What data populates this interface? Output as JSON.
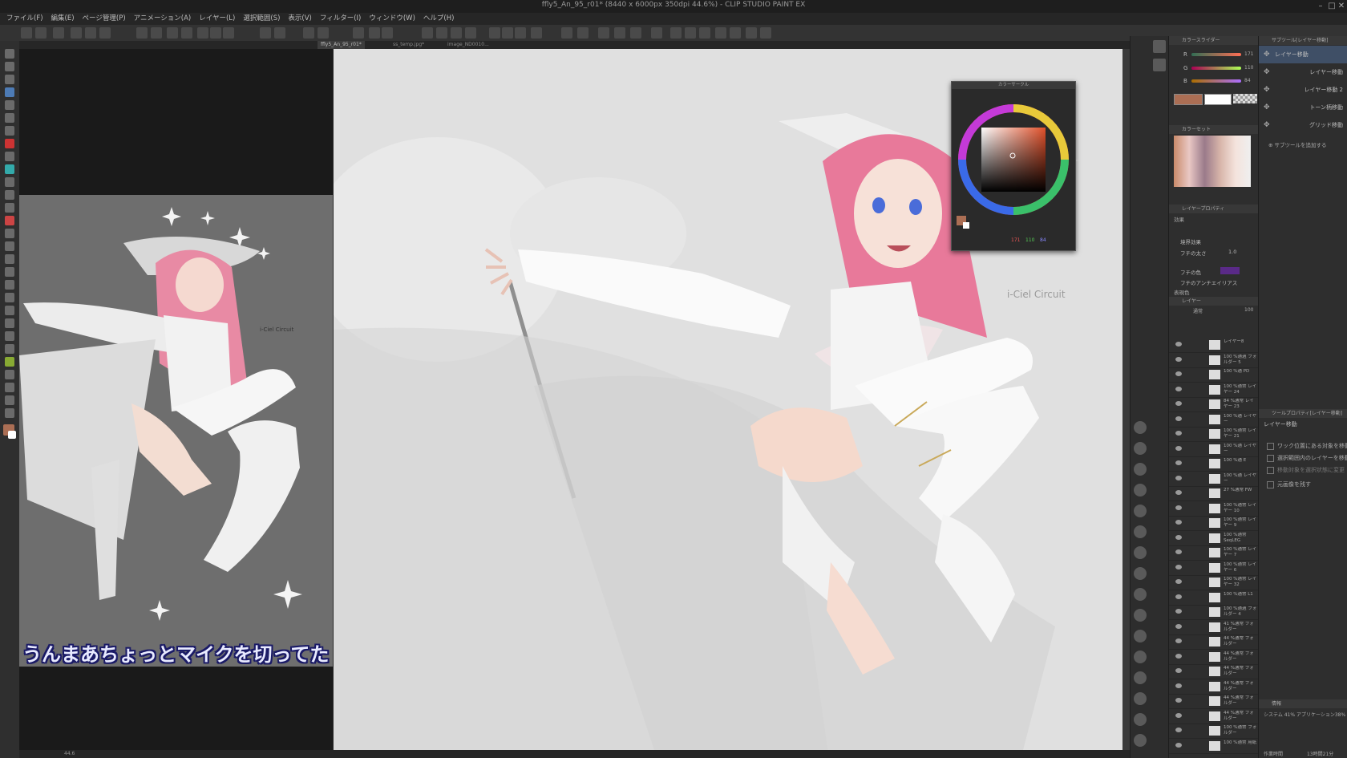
{
  "window": {
    "title": "ffly5_An_95_r01* (8440 x 6000px 350dpi 44.6%) - CLIP STUDIO PAINT EX",
    "controls": [
      "–",
      "□",
      "✕"
    ]
  },
  "menu": [
    "ファイル(F)",
    "編集(E)",
    "ページ管理(P)",
    "アニメーション(A)",
    "レイヤー(L)",
    "選択範囲(S)",
    "表示(V)",
    "フィルター(I)",
    "ウィンドウ(W)",
    "ヘルプ(H)"
  ],
  "tabs": [
    "ffly5_An_95_r01*",
    "ss_temp.jpg*",
    "image_ND0010..."
  ],
  "subtitle": "うんまあちょっとマイクを切ってた",
  "sketch_note": "i-Ciel Circuit",
  "color_slider": {
    "title": "カラースライダー",
    "rows": [
      {
        "label": "R",
        "value": "171"
      },
      {
        "label": "G",
        "value": "110"
      },
      {
        "label": "B",
        "value": "84"
      }
    ],
    "main_color": "#ab6e54"
  },
  "color_wheel": {
    "title": "カラーサークル",
    "readout": [
      "171",
      "110",
      "84"
    ]
  },
  "color_set": {
    "title": "カラーセット"
  },
  "layer_property": {
    "title": "レイヤープロパティ",
    "effect_label": "効果",
    "border_effect": "境界効果",
    "border_width_label": "フチの太さ",
    "border_width_value": "1.0",
    "border_color_label": "フチの色",
    "antialias_label": "フチのアンチエイリアス",
    "expression_label": "表現色"
  },
  "layer_panel": {
    "title": "レイヤー",
    "opacity": "100",
    "blend": "通常",
    "layers": [
      {
        "name": "レイヤー8"
      },
      {
        "name": "100 %通過 フォルダー 5"
      },
      {
        "name": "100 %通 PD"
      },
      {
        "name": "100 %通常 レイヤー 24"
      },
      {
        "name": "84 %通常 レイヤー 23"
      },
      {
        "name": "100 %通 レイヤー"
      },
      {
        "name": "100 %通常 レイヤー 21"
      },
      {
        "name": "100 %通 レイヤー"
      },
      {
        "name": "100 %通 E"
      },
      {
        "name": "100 %通 レイヤー"
      },
      {
        "name": "27 %通常 FW"
      },
      {
        "name": "100 %通常 レイヤー 10"
      },
      {
        "name": "100 %通常 レイヤー 9"
      },
      {
        "name": "100 %通常 SeqLEG"
      },
      {
        "name": "100 %通常 レイヤー 7"
      },
      {
        "name": "100 %通常 レイヤー 6"
      },
      {
        "name": "100 %通常 レイヤー 32"
      },
      {
        "name": "100 %通常 L1"
      },
      {
        "name": "100 %通過 フォルダー 4"
      },
      {
        "name": "41 %通常 フォルダー"
      },
      {
        "name": "44 %通常 フォルダー"
      },
      {
        "name": "44 %通常 フォルダー"
      },
      {
        "name": "44 %通常 フォルダー"
      },
      {
        "name": "44 %通常 フォルダー"
      },
      {
        "name": "44 %通常 フォルダー"
      },
      {
        "name": "44 %通常 フォルダー"
      },
      {
        "name": "100 %通常 フォルダー"
      },
      {
        "name": "100 %通常 用紙"
      }
    ]
  },
  "subtool_panel": {
    "title": "サブツール[レイヤー移動]",
    "items": [
      "レイヤー移動",
      "レイヤー移動",
      "レイヤー移動 2",
      "トーン柄移動",
      "グリッド移動"
    ],
    "add_label": "サブツールを追加する"
  },
  "tool_property": {
    "title": "ツールプロパティ[レイヤー移動]",
    "heading": "レイヤー移動",
    "options": [
      "ワック位置にある対象を移動",
      "選択範囲内のレイヤーを移動",
      "移動対象を選択状態に変更",
      "元画像を残す"
    ]
  },
  "info_panel": {
    "title": "情報",
    "text": "システム 41% アプリケーション38%"
  },
  "time_label": "作業時間",
  "time_value": "13時間21分",
  "zoom": "44.6",
  "colors": {
    "accent": "#3f4f66",
    "canvas_bg": "#e2e2e2",
    "hair": "#e87a9a"
  }
}
